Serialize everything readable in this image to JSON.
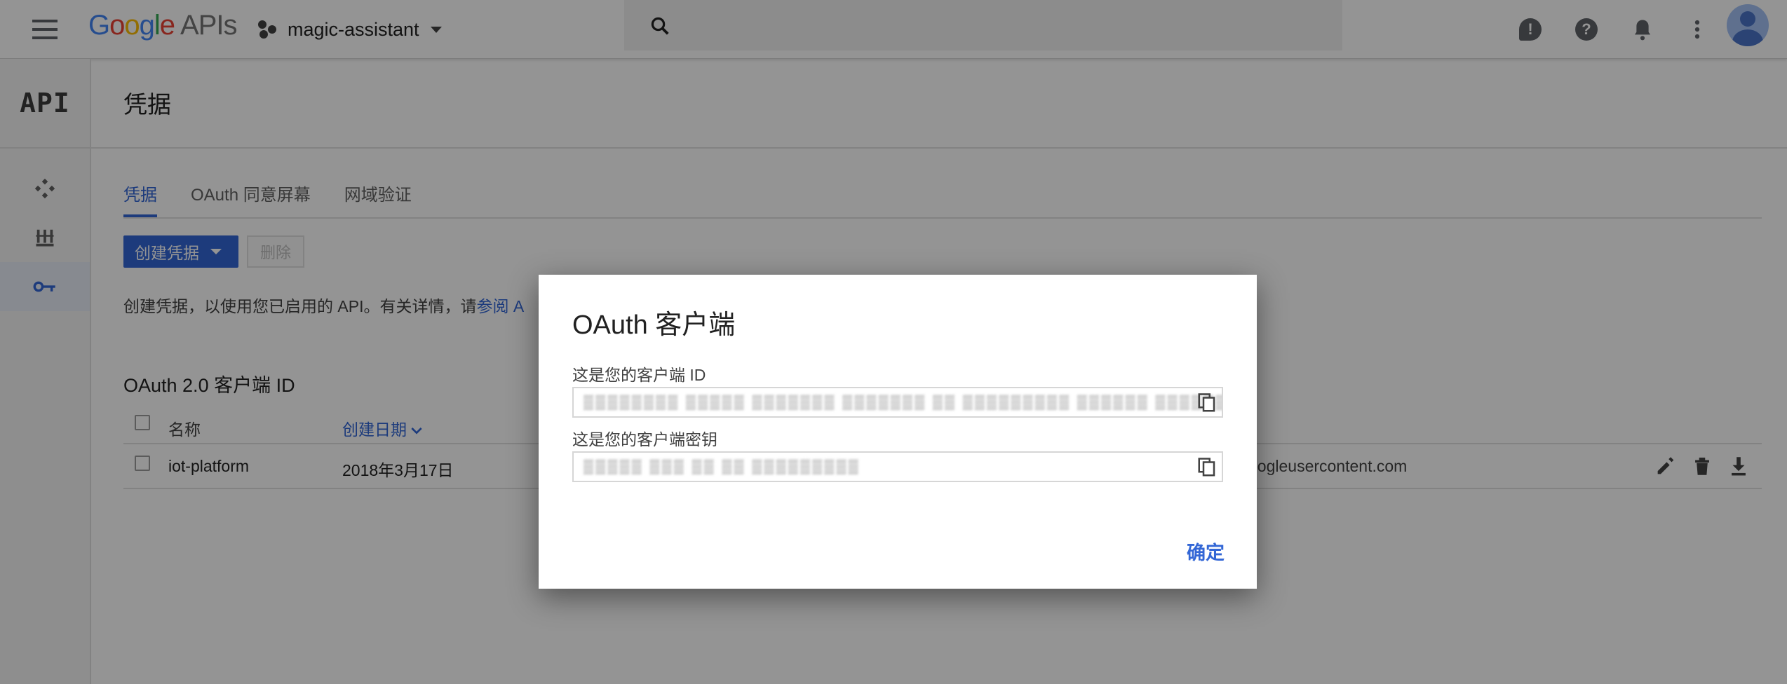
{
  "topbar": {
    "logo_google": "Google",
    "logo_apis": "APIs",
    "project_name": "magic-assistant"
  },
  "rail": {
    "api_label": "API",
    "items": [
      "dashboard-icon",
      "library-icon",
      "credentials-key-icon"
    ]
  },
  "page": {
    "title": "凭据",
    "tabs": [
      "凭据",
      "OAuth 同意屏幕",
      "网域验证"
    ],
    "create_button": "创建凭据",
    "delete_button": "删除",
    "info_text": "创建凭据，以使用您已启用的 API。有关详情，请",
    "info_link": "参阅 A",
    "section_title": "OAuth 2.0 客户端 ID",
    "table": {
      "columns": [
        "名称",
        "创建日期"
      ],
      "rows": [
        {
          "name": "iot-platform",
          "date": "2018年3月17日",
          "client_id_tail": "oogleusercontent.com"
        }
      ]
    }
  },
  "dialog": {
    "title": "OAuth 客户端",
    "client_id_label": "这是您的客户端 ID",
    "client_id_value": "▒▒▒▒▒▒▒▒ ▒▒▒▒▒ ▒▒▒▒▒▒▒ ▒▒▒▒▒▒▒ ▒▒ ▒▒▒▒▒▒▒▒▒ ▒▒▒▒▒▒ ▒▒▒▒▒▒ ▒▒▒▒ ▒ ▒ ▒ ▒",
    "client_secret_label": "这是您的客户端密钥",
    "client_secret_value": "▒▒▒▒▒ ▒▒▒ ▒▒ ▒▒ ▒▒▒▒▒▒▒▒▒",
    "ok_button": "确定"
  },
  "colors": {
    "accent": "#3367d6",
    "overlay": "rgba(0,0,0,0.42)"
  }
}
